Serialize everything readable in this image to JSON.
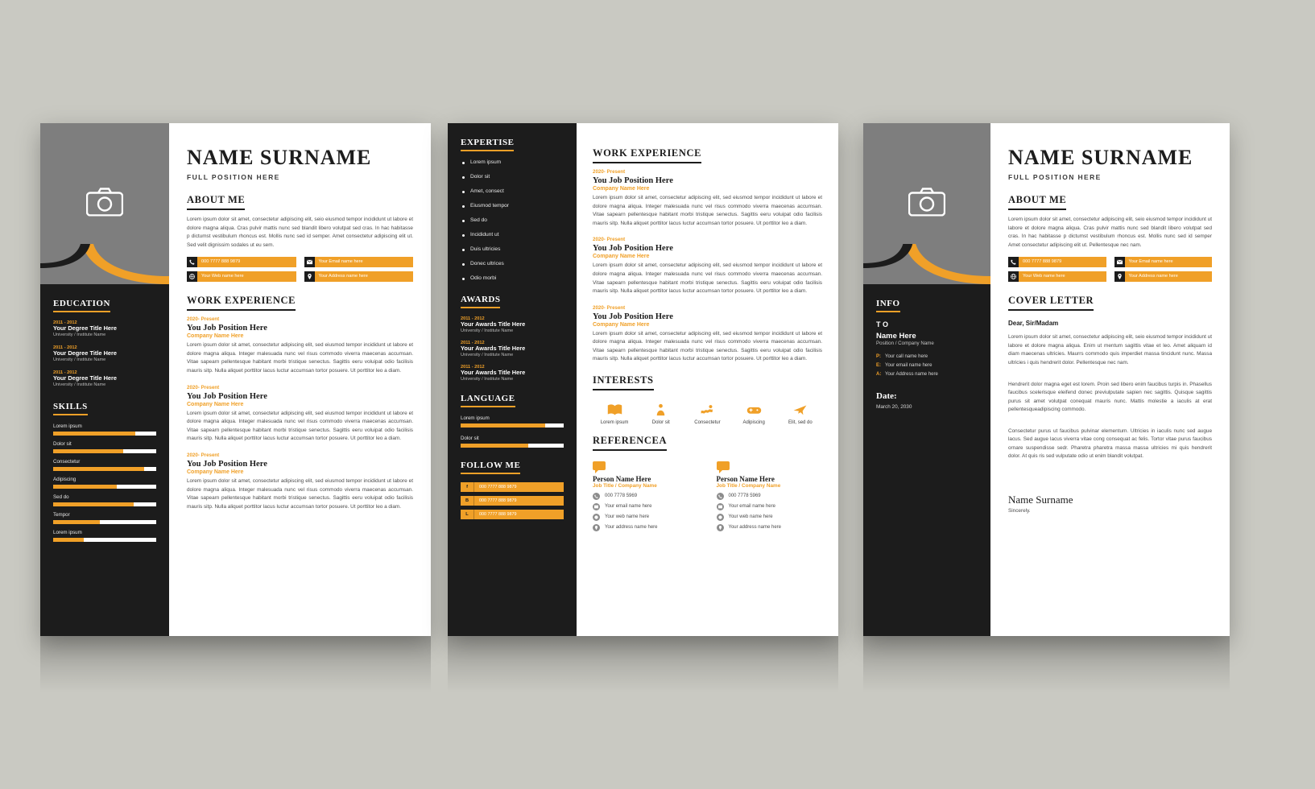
{
  "colors": {
    "accent": "#f0a028",
    "dark": "#1c1c1c",
    "photo": "#7e7e7e",
    "page_bg": "#c9c9c2"
  },
  "resume": {
    "name": "NAME SURNAME",
    "position": "FULL POSITION HERE",
    "about_heading": "ABOUT ME",
    "about_text": "Lorem ipsum dolor sit amet, consectetur adipiscing elit, seio eiusmod tempor incididunt ut labore et dolore magna aliqua. Cras pulvir mattis nunc sed blandit libero volutpat sed cras. In hac habitasse p dictumst vestibulum rhoncus est. Mollis nunc sed id semper. Amet consectetur adipiscing elit ut. Sed velit dignissim sodales ut eu sem.",
    "contacts": [
      {
        "icon": "phone-icon",
        "value": "000 7777 888 9879"
      },
      {
        "icon": "mail-icon",
        "value": "Your Email name here"
      },
      {
        "icon": "globe-icon",
        "value": "Your Web name here"
      },
      {
        "icon": "pin-icon",
        "value": "Your Address name here"
      }
    ],
    "work_heading": "WORK EXPERIENCE",
    "work": [
      {
        "years": "2020- Present",
        "role": "You Job Position Here",
        "company": "Company Name Here",
        "text": "Lorem ipsum dolor sit amet, consectetur adipiscing elit, sed eiusmod tempor incididunt ut labore et dolore magna aliqua. Integer malesuada nunc vel risus commodo viverra maecenas accumsan. Vitae sapearn pellentesque habitant morbi tristique senectus. Sagittis eeru voluipat odio facilisis mauris sitp. Nulla aliquet porttitor lacus luctur accumsan tortor posuere. Ut porttitor leo a diam."
      },
      {
        "years": "2020- Present",
        "role": "You Job Position Here",
        "company": "Company Name Here",
        "text": "Lorem ipsum dolor sit amet, consectetur adipiscing elit, sed eiusmod tempor incididunt ut labore et dolore magna aliqua. Integer malesuada nunc vel risus commodo viverra maecenas accumsan. Vitae sapearn pellentesque habitant morbi tristique senectus. Sagittis eeru voluipat odio facilisis mauris sitp. Nulla aliquet porttitor lacus luctur accumsan tortor posuere. Ut porttitor leo a diam."
      },
      {
        "years": "2020- Present",
        "role": "You Job Position Here",
        "company": "Company Name Here",
        "text": "Lorem ipsum dolor sit amet, consectetur adipiscing elit, sed eiusmod tempor incididunt ut labore et dolore magna aliqua. Integer malesuada nunc vel risus commodo viverra maecenas accumsan. Vitae sapearn pellentesque habitant morbi tristique senectus. Sagittis eeru voluipat odio facilisis mauris sitp. Nulla aliquet porttitor lacus luctur accumsan tortor posuere. Ut porttitor leo a diam."
      }
    ],
    "education_heading": "EDUCATION",
    "education": [
      {
        "years": "2011 - 2012",
        "title": "Your Degree Title Here",
        "school": "University / Institute Name"
      },
      {
        "years": "2011 - 2012",
        "title": "Your Degree Title Here",
        "school": "University / Institute Name"
      },
      {
        "years": "2011 - 2012",
        "title": "Your Degree Title Here",
        "school": "University / Institute Name"
      }
    ],
    "skills_heading": "SKILLS",
    "skills": [
      {
        "label": "Lorem ipsum",
        "pct": 80
      },
      {
        "label": "Dolor sit",
        "pct": 68
      },
      {
        "label": "Consectetur",
        "pct": 88
      },
      {
        "label": "Adipiscing",
        "pct": 62
      },
      {
        "label": "Sed do",
        "pct": 78
      },
      {
        "label": "Tempor",
        "pct": 45
      },
      {
        "label": "Lorem ipsum",
        "pct": 30
      }
    ]
  },
  "page2": {
    "expertise_heading": "EXPERTISE",
    "expertise": [
      "Lorem ipsum",
      "Dolor sit",
      "Amet, consect",
      "Eiusmod tempor",
      "Sed do",
      "Incididunt ut",
      "Duis ultricies",
      "Donec ultrices",
      "Odio morbi"
    ],
    "awards_heading": "AWARDS",
    "awards": [
      {
        "years": "2011 - 2012",
        "title": "Your Awards Title Here",
        "school": "University / Institute Name"
      },
      {
        "years": "2011 - 2012",
        "title": "Your Awards Title Here",
        "school": "University / Institute Name"
      },
      {
        "years": "2011 - 2012",
        "title": "Your Awards Title Here",
        "school": "University / Institute Name"
      }
    ],
    "language_heading": "LANGUAGE",
    "languages": [
      {
        "label": "Lorem ipsum",
        "pct": 82
      },
      {
        "label": "Dolor sit",
        "pct": 66
      }
    ],
    "follow_heading": "FOLLOW ME",
    "follow": [
      {
        "key": "f",
        "value": "000 7777 888 9879"
      },
      {
        "key": "B",
        "value": "000 7777 888 9879"
      },
      {
        "key": "L",
        "value": "000 7777 888 9879"
      }
    ],
    "work_heading": "WORK EXPERIENCE",
    "interests_heading": "INTERESTS",
    "interests": [
      {
        "icon": "book-icon",
        "label": "Lorem ipsum"
      },
      {
        "icon": "person-icon",
        "label": "Dolor sit"
      },
      {
        "icon": "swim-icon",
        "label": "Consectetur"
      },
      {
        "icon": "gamepad-icon",
        "label": "Adipiscing"
      },
      {
        "icon": "plane-icon",
        "label": "Elit, sed do"
      }
    ],
    "reference_heading": "REFERENCEA",
    "references": [
      {
        "name": "Person Name Here",
        "job": "Job Title / Company Name",
        "phone": "000 7778 5969",
        "email": "Your email name here",
        "web": "Your web name here",
        "address": "Your address name here"
      },
      {
        "name": "Person Name Here",
        "job": "Job Title / Company Name",
        "phone": "000 7778 5969",
        "email": "Your email name here",
        "web": "Your web name here",
        "address": "Your address name here"
      }
    ]
  },
  "page3": {
    "name": "NAME SURNAME",
    "position": "FULL POSITION HERE",
    "about_heading": "ABOUT ME",
    "about_text": "Lorem ipsum dolor sit amet, consectetur adipiscing elit, seio eiusmod tempor incididunt ut labore et dolore magna aliqua. Cras pulvir mattis nunc sed blandit libero volutpat sed cras. In hac habitasse p dictumst vestibulum rhoncus est. Mollis nunc sed id semper Amet consectetur adipiscing elit ut. Pellentesque nec nam.",
    "info_heading": "INFO",
    "to_label": "T O",
    "to_name": "Name Here",
    "to_position": "Position / Company Name",
    "info_rows": [
      {
        "key": "P:",
        "value": "Your  call name here"
      },
      {
        "key": "E:",
        "value": "Your  email name here"
      },
      {
        "key": "A:",
        "value": "Your  Address name here"
      }
    ],
    "date_heading": "Date:",
    "date_value": "March 20, 2030",
    "cover_heading": "COVER LETTER",
    "salutation": "Dear, Sir/Madam",
    "paragraphs": [
      "Lorem ipsum dolor sit amet, consectetur adipiscing elit, seio eiusmod tempor incididunt ut labore et dolore magna aliqua. Enim ut mentum sagittis vitae et leo. Amet aliquam id diam maecenas ultricies. Maurrs commodo quis imperdiet massa tincidunt nunc. Massa ultricies i quis hendrerit dolor. Pellentesque nec nam.",
      "Hendrerit dolor magna eget est lorem. Proin sed libero enim faucibus turpis in. Phasellus faucibus scelerisque eleifend donec previulputate sapien nec sagittis. Quisque sagittis purus sit amet volutpat conequat mauris nunc. Mattis molestie a iaculis at erat pellentesqueadipiscing commodo.",
      "Consectetur purus ut faucibus pulvinar elementum. Ultricies in iaculis nunc sed augue lacus. Sed augue lacus viverra vitae cong consequat ac felis. Tortor vitae purus faucibus ornare suspendisse sedr. Pharetra pharetra massa massa ultricies mi quis hendrerit dolor. At quis ris sed vulputate odio ut enim blandit volutpat."
    ],
    "sign_name": "Name Surname",
    "sign_sincerely": "Sincerely."
  }
}
